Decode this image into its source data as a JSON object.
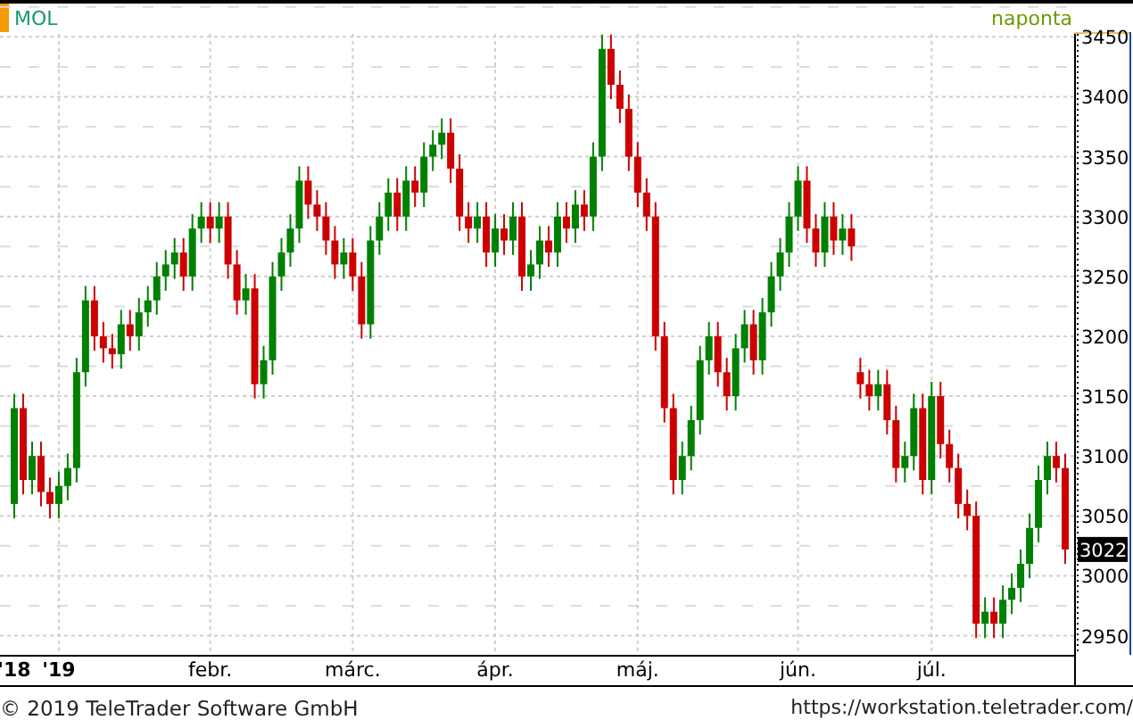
{
  "header": {
    "symbol": "MOL",
    "interval": "naponta"
  },
  "chart": {
    "chart_data": {
      "type": "candlestick",
      "grid": true,
      "ylim": [
        2934,
        3454
      ],
      "yticks": [
        2950,
        3000,
        3050,
        3100,
        3150,
        3200,
        3250,
        3300,
        3350,
        3400,
        3450
      ],
      "categories": [
        "'18",
        null,
        null,
        null,
        null,
        "'19",
        null,
        null,
        null,
        null,
        null,
        null,
        null,
        null,
        null,
        null,
        null,
        null,
        null,
        null,
        null,
        null,
        "febr.",
        null,
        null,
        null,
        null,
        null,
        null,
        null,
        null,
        null,
        null,
        null,
        null,
        null,
        null,
        null,
        "márc.",
        null,
        null,
        null,
        null,
        null,
        null,
        null,
        null,
        null,
        null,
        null,
        null,
        null,
        null,
        null,
        "ápr.",
        null,
        null,
        null,
        null,
        null,
        null,
        null,
        null,
        null,
        null,
        null,
        null,
        null,
        null,
        null,
        "máj.",
        null,
        null,
        null,
        null,
        null,
        null,
        null,
        null,
        null,
        null,
        null,
        null,
        null,
        null,
        null,
        null,
        null,
        "jún.",
        null,
        null,
        null,
        null,
        null,
        null,
        null,
        null,
        null,
        null,
        null,
        null,
        null,
        null,
        "júl.",
        null,
        null,
        null,
        null,
        null,
        null,
        null,
        null,
        null,
        null,
        null,
        null,
        null,
        null,
        null
      ],
      "ohlc": [
        [
          3060,
          3152,
          3048,
          3140
        ],
        [
          3140,
          3152,
          3068,
          3080
        ],
        [
          3080,
          3112,
          3068,
          3100
        ],
        [
          3100,
          3112,
          3058,
          3070
        ],
        [
          3070,
          3082,
          3048,
          3060
        ],
        [
          3060,
          3087,
          3048,
          3075
        ],
        [
          3075,
          3102,
          3063,
          3090
        ],
        [
          3090,
          3182,
          3078,
          3170
        ],
        [
          3170,
          3242,
          3158,
          3230
        ],
        [
          3230,
          3242,
          3188,
          3200
        ],
        [
          3200,
          3212,
          3178,
          3190
        ],
        [
          3190,
          3202,
          3173,
          3185
        ],
        [
          3185,
          3222,
          3173,
          3210
        ],
        [
          3210,
          3222,
          3188,
          3200
        ],
        [
          3200,
          3232,
          3188,
          3220
        ],
        [
          3220,
          3242,
          3208,
          3230
        ],
        [
          3230,
          3262,
          3218,
          3250
        ],
        [
          3250,
          3272,
          3238,
          3260
        ],
        [
          3260,
          3282,
          3248,
          3270
        ],
        [
          3270,
          3282,
          3238,
          3250
        ],
        [
          3250,
          3302,
          3238,
          3290
        ],
        [
          3290,
          3312,
          3278,
          3300
        ],
        [
          3300,
          3312,
          3278,
          3290
        ],
        [
          3290,
          3312,
          3278,
          3300
        ],
        [
          3300,
          3312,
          3248,
          3260
        ],
        [
          3260,
          3272,
          3218,
          3230
        ],
        [
          3230,
          3252,
          3218,
          3240
        ],
        [
          3240,
          3252,
          3148,
          3160
        ],
        [
          3160,
          3192,
          3148,
          3180
        ],
        [
          3180,
          3262,
          3168,
          3250
        ],
        [
          3250,
          3282,
          3238,
          3270
        ],
        [
          3270,
          3302,
          3258,
          3290
        ],
        [
          3290,
          3342,
          3278,
          3330
        ],
        [
          3330,
          3342,
          3298,
          3310
        ],
        [
          3310,
          3322,
          3288,
          3300
        ],
        [
          3300,
          3312,
          3268,
          3280
        ],
        [
          3280,
          3292,
          3248,
          3260
        ],
        [
          3260,
          3282,
          3248,
          3270
        ],
        [
          3270,
          3282,
          3238,
          3250
        ],
        [
          3250,
          3262,
          3198,
          3210
        ],
        [
          3210,
          3292,
          3198,
          3280
        ],
        [
          3280,
          3312,
          3268,
          3300
        ],
        [
          3300,
          3332,
          3288,
          3320
        ],
        [
          3320,
          3332,
          3288,
          3300
        ],
        [
          3300,
          3342,
          3288,
          3330
        ],
        [
          3330,
          3342,
          3308,
          3320
        ],
        [
          3320,
          3362,
          3308,
          3350
        ],
        [
          3350,
          3372,
          3338,
          3360
        ],
        [
          3360,
          3382,
          3348,
          3370
        ],
        [
          3370,
          3382,
          3328,
          3340
        ],
        [
          3340,
          3352,
          3288,
          3300
        ],
        [
          3300,
          3312,
          3278,
          3290
        ],
        [
          3290,
          3312,
          3278,
          3300
        ],
        [
          3300,
          3312,
          3258,
          3270
        ],
        [
          3270,
          3302,
          3258,
          3290
        ],
        [
          3290,
          3302,
          3268,
          3280
        ],
        [
          3280,
          3312,
          3268,
          3300
        ],
        [
          3300,
          3312,
          3238,
          3250
        ],
        [
          3250,
          3272,
          3238,
          3260
        ],
        [
          3260,
          3292,
          3248,
          3280
        ],
        [
          3280,
          3292,
          3258,
          3270
        ],
        [
          3270,
          3312,
          3258,
          3300
        ],
        [
          3300,
          3312,
          3278,
          3290
        ],
        [
          3290,
          3322,
          3278,
          3310
        ],
        [
          3310,
          3322,
          3288,
          3300
        ],
        [
          3300,
          3362,
          3288,
          3350
        ],
        [
          3350,
          3452,
          3338,
          3440
        ],
        [
          3440,
          3452,
          3398,
          3410
        ],
        [
          3410,
          3422,
          3378,
          3390
        ],
        [
          3390,
          3402,
          3338,
          3350
        ],
        [
          3350,
          3362,
          3308,
          3320
        ],
        [
          3320,
          3332,
          3288,
          3300
        ],
        [
          3300,
          3312,
          3188,
          3200
        ],
        [
          3200,
          3212,
          3128,
          3140
        ],
        [
          3140,
          3152,
          3068,
          3080
        ],
        [
          3080,
          3112,
          3068,
          3100
        ],
        [
          3100,
          3142,
          3088,
          3130
        ],
        [
          3130,
          3192,
          3118,
          3180
        ],
        [
          3180,
          3212,
          3168,
          3200
        ],
        [
          3200,
          3212,
          3158,
          3170
        ],
        [
          3170,
          3182,
          3138,
          3150
        ],
        [
          3150,
          3202,
          3138,
          3190
        ],
        [
          3190,
          3222,
          3178,
          3210
        ],
        [
          3210,
          3222,
          3168,
          3180
        ],
        [
          3180,
          3232,
          3168,
          3220
        ],
        [
          3220,
          3262,
          3208,
          3250
        ],
        [
          3250,
          3282,
          3238,
          3270
        ],
        [
          3270,
          3312,
          3258,
          3300
        ],
        [
          3300,
          3342,
          3288,
          3330
        ],
        [
          3330,
          3342,
          3278,
          3290
        ],
        [
          3290,
          3302,
          3258,
          3270
        ],
        [
          3270,
          3312,
          3258,
          3300
        ],
        [
          3300,
          3312,
          3268,
          3280
        ],
        [
          3280,
          3302,
          3268,
          3290
        ],
        [
          3290,
          3302,
          3263,
          3275
        ],
        [
          3170,
          3182,
          3148,
          3160
        ],
        [
          3160,
          3172,
          3138,
          3150
        ],
        [
          3150,
          3172,
          3138,
          3160
        ],
        [
          3160,
          3172,
          3118,
          3130
        ],
        [
          3130,
          3142,
          3078,
          3090
        ],
        [
          3090,
          3112,
          3078,
          3100
        ],
        [
          3100,
          3152,
          3088,
          3140
        ],
        [
          3140,
          3152,
          3068,
          3080
        ],
        [
          3080,
          3162,
          3068,
          3150
        ],
        [
          3150,
          3162,
          3098,
          3110
        ],
        [
          3110,
          3122,
          3078,
          3090
        ],
        [
          3090,
          3102,
          3048,
          3060
        ],
        [
          3060,
          3072,
          3038,
          3050
        ],
        [
          3050,
          3062,
          2948,
          2960
        ],
        [
          2960,
          2982,
          2948,
          2970
        ],
        [
          2970,
          2982,
          2948,
          2960
        ],
        [
          2960,
          2992,
          2948,
          2980
        ],
        [
          2980,
          3002,
          2968,
          2990
        ],
        [
          2990,
          3022,
          2978,
          3010
        ],
        [
          3010,
          3052,
          2998,
          3040
        ],
        [
          3040,
          3092,
          3028,
          3080
        ],
        [
          3080,
          3112,
          3068,
          3100
        ],
        [
          3100,
          3112,
          3078,
          3090
        ],
        [
          3090,
          3102,
          3010,
          3022
        ]
      ]
    },
    "last_price": "3022"
  },
  "footer": {
    "copyright": "© 2019 TeleTrader Software GmbH",
    "url": "https://workstation.teletrader.com/"
  }
}
